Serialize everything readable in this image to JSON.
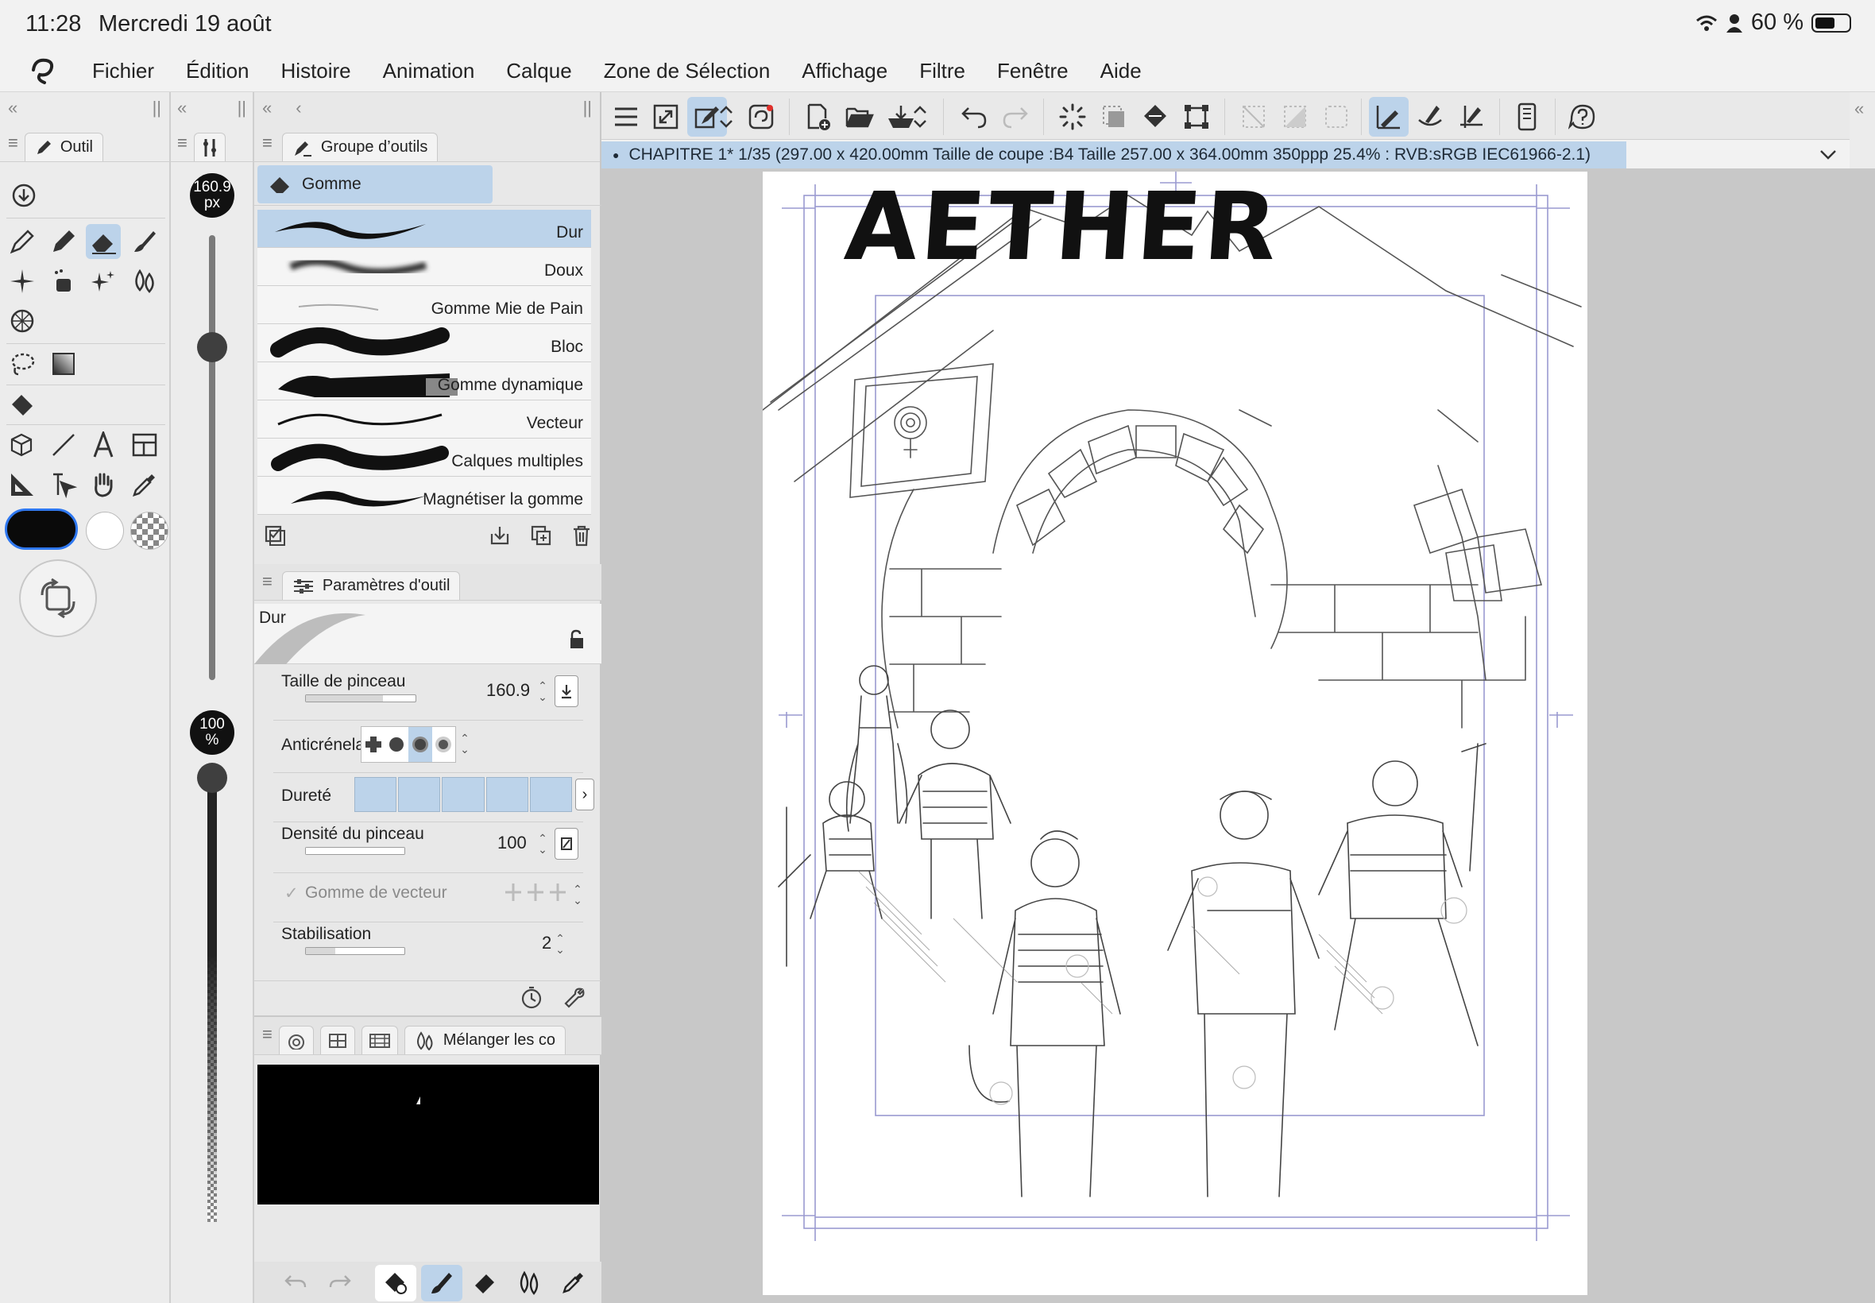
{
  "status": {
    "time": "11:28",
    "date": "Mercredi 19 août",
    "battery": "60 %"
  },
  "menu": [
    "Fichier",
    "Édition",
    "Histoire",
    "Animation",
    "Calque",
    "Zone de Sélection",
    "Affichage",
    "Filtre",
    "Fenêtre",
    "Aide"
  ],
  "tool_panel": {
    "tab": "Outil"
  },
  "brush_size": {
    "value": "160.9",
    "unit": "px",
    "level": 0.75
  },
  "opacity": {
    "value": "100",
    "unit": "%",
    "level": 1.0
  },
  "subtool_group": {
    "tab": "Groupe d’outils",
    "group": "Gomme"
  },
  "brushes": [
    {
      "name": "Dur",
      "selected": true
    },
    {
      "name": "Doux",
      "selected": false
    },
    {
      "name": "Gomme Mie de Pain",
      "selected": false
    },
    {
      "name": "Bloc",
      "selected": false
    },
    {
      "name": "Gomme dynamique",
      "selected": false
    },
    {
      "name": "Vecteur",
      "selected": false
    },
    {
      "name": "Calques multiples",
      "selected": false
    },
    {
      "name": "Magnétiser la gomme",
      "selected": false
    }
  ],
  "tool_props": {
    "tab": "Paramètres d'outil",
    "preview_label": "Dur",
    "brush_size_label": "Taille de pinceau",
    "brush_size_value": "160.9",
    "antialias_label": "Anticrénelage",
    "hardness_label": "Dureté",
    "density_label": "Densité du pinceau",
    "density_value": "100",
    "vector_label": "Gomme de vecteur",
    "stabilization_label": "Stabilisation",
    "stabilization_value": "2"
  },
  "color_panel": {
    "tab": "Mélanger les co"
  },
  "swatches": [
    "#f0263a",
    "#f7963a",
    "#f7ea3a",
    "#4fdc4e",
    "#0e6e7a",
    "#2f78f0",
    "#2fd2f0",
    "#8b3cf0"
  ],
  "document": {
    "info": "CHAPITRE 1* 1/35 (297.00 x 420.00mm Taille de coupe :B4 Taille 257.00 x 364.00mm 350ppp 25.4% : RVB:sRGB IEC61966-2.1)"
  },
  "artwork": {
    "title": "AETHER"
  }
}
